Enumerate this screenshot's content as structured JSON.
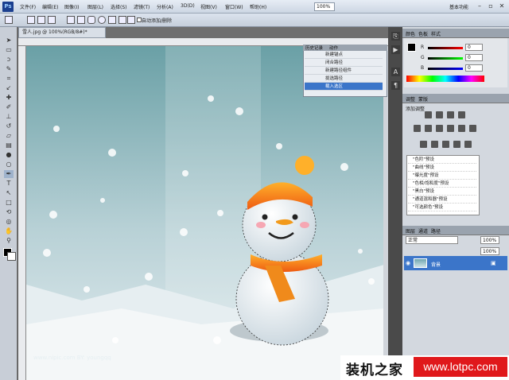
{
  "app": {
    "logo": "Ps",
    "document_tab": "雪人.jpg @ 100%(RGB/8#)*"
  },
  "menu": [
    "文件(F)",
    "编辑(E)",
    "图像(I)",
    "图层(L)",
    "选择(S)",
    "滤镜(T)",
    "分析(A)",
    "3D(D)",
    "视图(V)",
    "窗口(W)",
    "帮助(H)"
  ],
  "zoom": "100%",
  "workspace": "基本功能",
  "options_bar": {
    "auto_add_delete": "自动添加/删除"
  },
  "panels": {
    "color_tabs": [
      "颜色",
      "色板",
      "样式"
    ],
    "color_values": {
      "r": "0",
      "g": "0",
      "b": "0"
    },
    "color_letters": {
      "r": "R",
      "g": "G",
      "b": "B"
    },
    "adjust_tabs": [
      "调整",
      "蒙版"
    ],
    "adjust_title": "添加调整",
    "presets": [
      "\"色阶\"预设",
      "\"曲线\"预设",
      "\"曝光度\"预设",
      "\"色相/饱和度\"预设",
      "\"黑白\"预设",
      "\"通道混和器\"预设",
      "\"可选颜色\"预设"
    ],
    "layers_tabs": [
      "图层",
      "通道",
      "路径"
    ],
    "blend_mode": "正常",
    "opacity": "100%",
    "fill": "100%",
    "layer_name": "背景"
  },
  "history": {
    "tabs": [
      "历史记录",
      "动作"
    ],
    "items": [
      "新建锚点",
      "闭合路径",
      "新建路径组件",
      "拢选路径",
      "载入选区"
    ]
  },
  "canvas_credit": "www.nipic.com    BY: youngqq",
  "watermark": {
    "cn": "装机之家",
    "url": "www.lotpc.com"
  },
  "colors": {
    "panel_bg": "#d3d8df",
    "selection": "#3b75c9",
    "watermark_red": "#e0181b"
  }
}
